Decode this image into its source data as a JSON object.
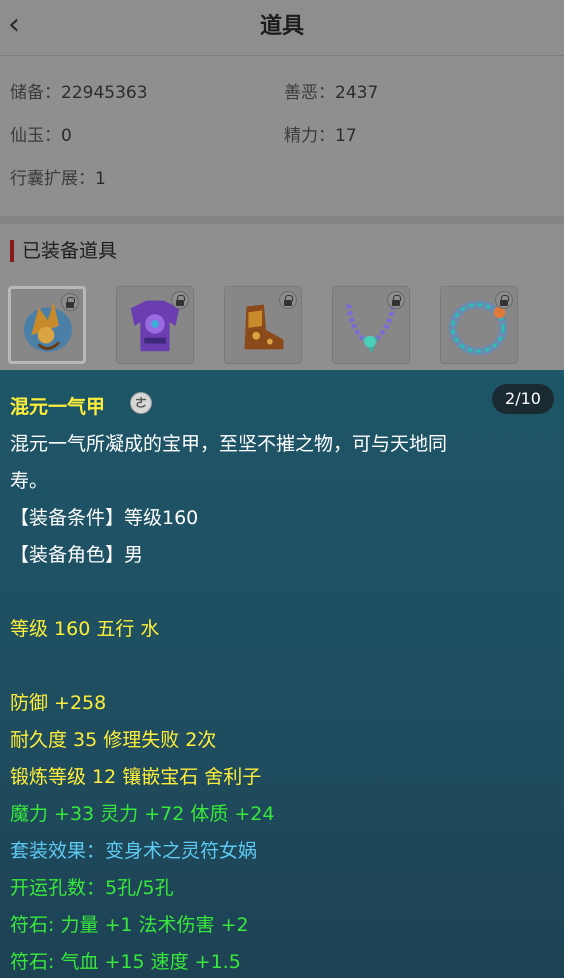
{
  "header": {
    "title": "道具",
    "back_icon": "chevron-left-icon"
  },
  "stats": {
    "savings_label": "储备：",
    "savings_value": "22945363",
    "karma_label": "善恶：",
    "karma_value": "2437",
    "jade_label": "仙玉：",
    "jade_value": "0",
    "energy_label": "精力：",
    "energy_value": "17",
    "bag_label": "行囊扩展：",
    "bag_value": "1"
  },
  "equipped": {
    "title": "已装备道具",
    "items": [
      {
        "name": "helmet",
        "locked": true,
        "selected": true
      },
      {
        "name": "armor",
        "locked": true,
        "selected": false
      },
      {
        "name": "boots",
        "locked": true,
        "selected": false
      },
      {
        "name": "necklace",
        "locked": true,
        "selected": false
      },
      {
        "name": "ring",
        "locked": true,
        "selected": false
      }
    ]
  },
  "tooltip": {
    "name": "混元一气甲",
    "coin_glyph": "ㄜ",
    "page": "2/10",
    "desc1": "混元一气所凝成的宝甲，至坚不摧之物，可与天地同",
    "desc2": "寿。",
    "req_level": "【装备条件】等级160",
    "req_role": "【装备角色】男",
    "level_element": "等级 160 五行 水",
    "defense": "防御 +258",
    "durability": "耐久度 35 修理失败 2次",
    "forge": "锻炼等级 12 镶嵌宝石 舍利子",
    "attrs": "魔力 +33 灵力 +72 体质 +24",
    "set_effect": "套装效果：变身术之灵符女娲",
    "luck_holes": "开运孔数：5孔/5孔",
    "rune1": "符石: 力量 +1 法术伤害 +2",
    "rune2": "符石: 气血 +15 速度 +1.5"
  },
  "colors": {
    "yellow": "#ffef3a",
    "green": "#38e83a",
    "blue": "#5ec9f2",
    "white": "#ffffff",
    "panel": "#1f4e60"
  }
}
